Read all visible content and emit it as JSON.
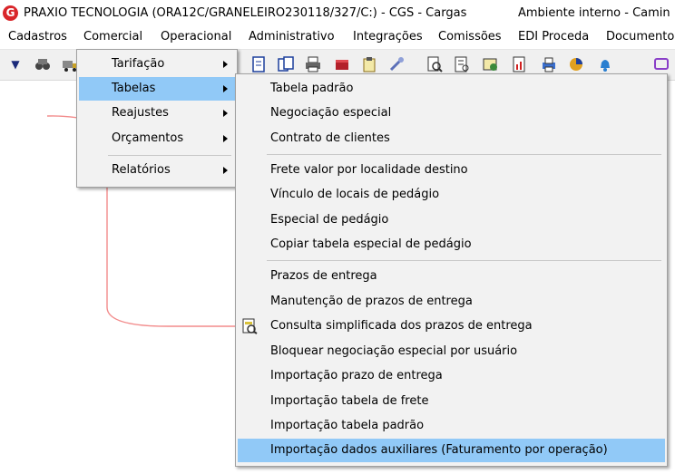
{
  "titlebar": {
    "logo_text": "G",
    "title": "PRAXIO TECNOLOGIA (ORA12C/GRANELEIRO230118/327/C:) - CGS - Cargas",
    "environment": "Ambiente interno - Camin"
  },
  "menubar": {
    "items": [
      "Cadastros",
      "Comercial",
      "Operacional",
      "Administrativo",
      "Integrações",
      "Comissões",
      "EDI Proceda",
      "Documento"
    ]
  },
  "toolbar": {
    "icons": [
      "arrow-down-double-icon",
      "binoculars-icon",
      "truck-icon",
      "document-icon",
      "documents-icon",
      "printer-icon",
      "book-icon",
      "clipboard-icon",
      "tools-icon",
      "search-document-icon",
      "report-icon",
      "certificate-icon",
      "chart-icon",
      "printer2-icon",
      "pie-chart-icon",
      "bell-icon",
      "window-icon"
    ]
  },
  "comercial_menu": {
    "items": [
      {
        "label": "Tarifação",
        "has_submenu": true
      },
      {
        "label": "Tabelas",
        "has_submenu": true,
        "highlighted": true
      },
      {
        "label": "Reajustes",
        "has_submenu": true
      },
      {
        "label": "Orçamentos",
        "has_submenu": true
      },
      {
        "label": "Relatórios",
        "has_submenu": true
      }
    ]
  },
  "tabelas_submenu": {
    "items": [
      {
        "label": "Tabela padrão"
      },
      {
        "label": "Negociação especial"
      },
      {
        "label": "Contrato de clientes"
      },
      {
        "label": "Frete valor por localidade destino"
      },
      {
        "label": "Vínculo de locais de pedágio"
      },
      {
        "label": "Especial de pedágio"
      },
      {
        "label": "Copiar tabela especial de pedágio"
      },
      {
        "label": "Prazos de entrega"
      },
      {
        "label": "Manutenção de prazos de entrega"
      },
      {
        "label": "Consulta simplificada dos prazos de entrega",
        "icon": "consult-document-icon"
      },
      {
        "label": "Bloquear negociação especial por usuário"
      },
      {
        "label": "Importação prazo de entrega"
      },
      {
        "label": "Importação tabela de frete"
      },
      {
        "label": "Importação tabela padrão"
      },
      {
        "label": "Importação dados auxiliares (Faturamento por operação)",
        "highlighted": true
      }
    ]
  },
  "colors": {
    "highlight": "#91c9f7",
    "connector_line": "#f28b8b",
    "logo": "#d9262a"
  }
}
